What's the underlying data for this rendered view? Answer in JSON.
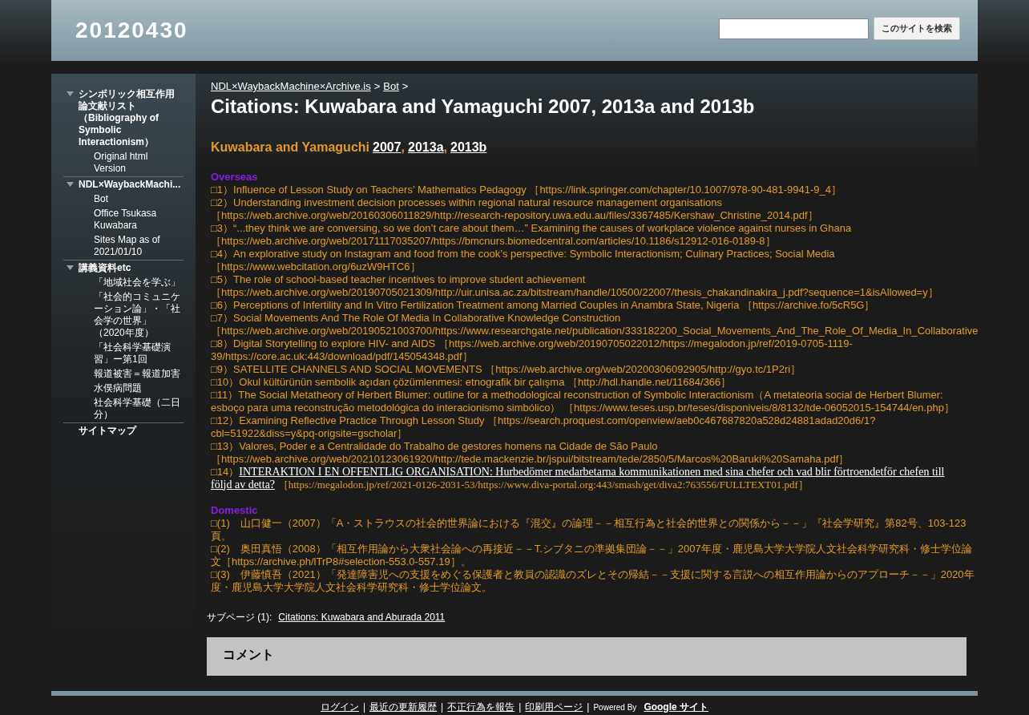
{
  "site": {
    "title": "20120430"
  },
  "search": {
    "button": "このサイトを検索"
  },
  "sidebar": {
    "items": [
      {
        "label": "シンボリック相互作用論文献リスト（Bibliography of Symbolic Interactionism）",
        "expanded": true,
        "children": [
          {
            "label": "Original html Version"
          }
        ]
      },
      {
        "label": "NDL×WaybackMachi...",
        "expanded": true,
        "children": [
          {
            "label": "Bot"
          },
          {
            "label": "Office Tsukasa Kuwabara"
          },
          {
            "label": "Sites Map as of 2021/01/10"
          }
        ]
      },
      {
        "label": "講義資料etc",
        "expanded": true,
        "children": [
          {
            "label": "「地域社会を学ぶ」"
          },
          {
            "label": "「社会的コミュニケーション論」・「社会学の世界」（2020年度）"
          },
          {
            "label": "「社会科学基礎演習」ー第1回"
          },
          {
            "label": "報道被害＝報道加害"
          },
          {
            "label": "水俣病問題"
          },
          {
            "label": "社会科学基礎（二日分）"
          }
        ]
      },
      {
        "label": "サイトマップ"
      }
    ]
  },
  "breadcrumb": [
    {
      "label": "NDL×WaybackMachine×Archive.is"
    },
    {
      "label": "Bot"
    }
  ],
  "breadcrumb_separator": ">",
  "page_title": "Citations: Kuwabara and Yamaguchi 2007, 2013a and 2013b",
  "heading": {
    "text": "Kuwabara and Yamaguchi",
    "links": [
      "2007",
      "2013a",
      "2013b"
    ],
    "separator": ","
  },
  "sections": [
    {
      "title": "Overseas",
      "entries": [
        {
          "kind": "plain",
          "marker": "□1）",
          "title": "Influence of Lesson Study on Teachers’ Mathematics Pedagogy",
          "source": "［https://link.springer.com/chapter/10.1007/978-90-481-9941-9_4］",
          "break_before_source": false
        },
        {
          "kind": "plain",
          "marker": "□2）",
          "title": "Understanding investment decision processes within regional natural resource management organisations",
          "source": "［https://web.archive.org/web/20160306011829/http://research-repository.uwa.edu.au/files/3367485/Kershaw_Christine_2014.pdf］",
          "break_before_source": true
        },
        {
          "kind": "plain",
          "marker": "□3）",
          "title": "“...they think we are conversing, so we don’t care about them…” Examining the causes of workplace violence against nurses in Ghana",
          "source": "［https://web.archive.org/web/20171117035207/https://bmcnurs.biomedcentral.com/articles/10.1186/s12912-016-0189-8］",
          "break_before_source": true
        },
        {
          "kind": "plain",
          "marker": "□4）",
          "title": "An explorative study on Instagram and food from the cook’s perspective: Symbolic Interactionism; Culinary Practices; Social Media",
          "source": "［https://www.webcitation.org/6uzW9HTC6］",
          "break_before_source": true
        },
        {
          "kind": "plain",
          "marker": "□5）",
          "title": "The role of school-based teacher incentives to improve student achievement",
          "source": "［https://web.archive.org/web/20190705021309/http://uir.unisa.ac.za/bitstream/handle/10500/22007/thesis_chakandinakira_j.pdf?sequence=1&isAllowed=y］",
          "break_before_source": true
        },
        {
          "kind": "plain",
          "marker": "□6）",
          "title": "Perceptions of Infertility and In Vitro Fertilization Treatment among Married Couples in Anambra State, Nigeria",
          "source": "［https://archive.fo/5cR5G］",
          "break_before_source": false
        },
        {
          "kind": "plain",
          "marker": "□7）",
          "title": "Social Movements And The Role Of Media In Collaborative Knowledge Construction",
          "source": "［https://web.archive.org/web/20190521003700/https://www.researchgate.net/publication/333182200_Social_Movements_And_The_Role_Of_Media_In_Collaborative",
          "break_before_source": true
        },
        {
          "kind": "plain",
          "marker": "□8）",
          "title": "Digital Storytelling to explore HIV- and AIDS",
          "source": "［https://web.archive.org/web/20190705022012/https://megalodon.jp/ref/2019-0705-1119-39/https://core.ac.uk:443/download/pdf/145054348.pdf］",
          "break_before_source": false
        },
        {
          "kind": "plain",
          "marker": "□9）",
          "title": "SATELLITE CHANNELS AND SOCIAL MOVEMENTS",
          "source": "［https://web.archive.org/web/20200306092905/http://gyo.tc/1P2ri］",
          "break_before_source": false
        },
        {
          "kind": "plain",
          "marker": "□10）",
          "title": "Okul kültürünün sembolik açıdan çözümlenmesi: etnografik bir çalışma",
          "source": "［http://hdl.handle.net/11684/366］",
          "break_before_source": false
        },
        {
          "kind": "plain",
          "marker": "□11）",
          "title": "The Social Metatheory of Herbert Blumer: outline for a methodological reconstruction of Symbolic Interactionism（A metateoria social de Herbert Blumer: esboço para uma reconstrução metodológica do interacionismo simbólico）",
          "source": "［https://www.teses.usp.br/teses/disponiveis/8/8132/tde-06052015-154744/en.php］",
          "break_before_source": false
        },
        {
          "kind": "plain",
          "marker": "□12）",
          "title": "Examining Reflective Practice Through Lesson Study",
          "source": "［https://search.proquest.com/openview/aeb0c467687820a528d24881adad20d6/1?cbl=51922&diss=y&pq-origsite=gscholar］",
          "break_before_source": false
        },
        {
          "kind": "plain",
          "marker": "□13）",
          "title": "Valores, Poder e a Centralidade do Trabalho de gestores homens na Cidade de São Paulo",
          "source": "［https://web.archive.org/web/20210123061920/http://tede.mackenzie.br/jspui/bitstream/tede/2850/5/Marcos%20Baruki%20Samaha.pdf］",
          "break_before_source": true
        },
        {
          "kind": "link",
          "marker": "□14）",
          "title_lines": [
            "INTERAKTION I EN OFFENTLIG ORGANISATION: Hurbedömer medarbetarna kommunikationen med sina chefer och vad blir förtroendetför chefen till",
            "följd av detta?"
          ],
          "source": "［https://megalodon.jp/ref/2021-0126-2031-53/https://www.diva-portal.org:443/smash/get/diva2:763556/FULLTEXT01.pdf］",
          "break_before_source": false
        }
      ]
    },
    {
      "title": "Domestic",
      "entries": [
        {
          "kind": "plain",
          "marker": "□(1)　",
          "title": "山口健一（2007）「A・ストラウスの社会的世界論における『混交』の論理－－相互行為と社会的世界との関係から－－」『社会学研究』第82号、103-123頁。"
        },
        {
          "kind": "plain",
          "marker": "□(2)　",
          "title": "奥田真悟（2008）「相互作用論から大衆社会論への再接近－－T.シブタニの準拠集団論－－」2007年度・鹿児島大学大学院人文社会科学研究科・修士学位論文［https://archive.ph/lTrP8#selection-553.0-557.19］。"
        },
        {
          "kind": "plain",
          "marker": "□(3)　",
          "title": "伊藤慎吾（2021）「発達障害児への支援をめぐる保護者と教員の認識のズレとその帰結－－支援に関する言説への相互作用論からのアプローチ－－」2020年度・鹿児島大学大学院人文社会科学研究科・修士学位論文。"
        }
      ]
    }
  ],
  "subpages": {
    "label": "サブページ (1):",
    "links": [
      "Citations: Kuwabara and Aburada 2011"
    ]
  },
  "comments": {
    "title": "コメント"
  },
  "footer": {
    "links": [
      "ログイン",
      "最近の更新履歴",
      "不正行為を報告",
      "印刷用ページ"
    ],
    "separator": "|",
    "powered_by": "Powered By",
    "brand": "Google サイト"
  }
}
